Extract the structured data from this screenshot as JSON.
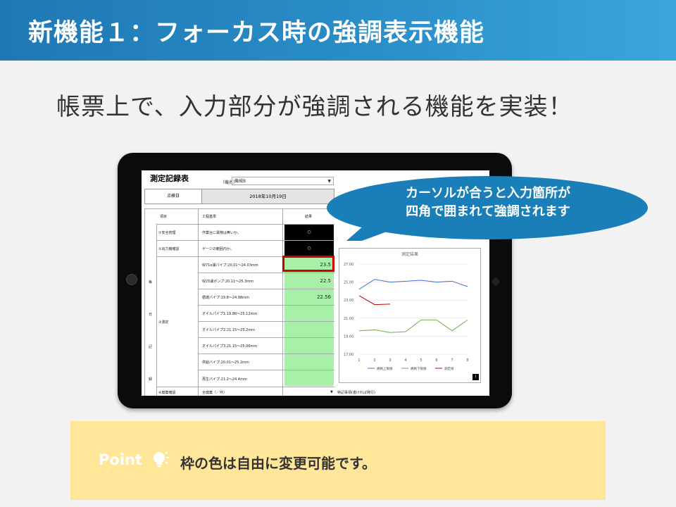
{
  "slide": {
    "title": "新機能１：フォーカス時の強調表示機能",
    "subtitle": "帳票上で、入力部分が強調される機能を実装！",
    "colors": {
      "header": "#1f78b4",
      "bubble": "#1a7fb8",
      "point_bg": "#ffe699",
      "highlight_frame": "#cc0000",
      "input_green": "#a8f0a8"
    }
  },
  "form": {
    "title": "測定記録表",
    "machine_label": "（機名）",
    "machine_value": "機械B",
    "date_label": "点検日",
    "date_value": "2018年10月19日",
    "headers": {
      "item": "項目",
      "standard": "工程基準",
      "result": "結果"
    },
    "left_vertical": [
      "毎",
      "日",
      "記",
      "録"
    ],
    "groups": [
      {
        "name": "①安全管理",
        "rows": [
          {
            "standard": "作業台に異物は無いか。",
            "value": "○",
            "style": "black"
          }
        ]
      },
      {
        "name": "②出力機確認",
        "rows": [
          {
            "standard": "ゲージの範囲内か。",
            "value": "○",
            "style": "black"
          }
        ]
      },
      {
        "name": "③測定",
        "rows": [
          {
            "standard": "W71α濾パイプ:20.01〜24.03mm",
            "value": "23.5",
            "style": "green",
            "focused": true
          },
          {
            "standard": "W25濾ポンプ:20.11〜25.3mm",
            "value": "22.5",
            "style": "green"
          },
          {
            "standard": "循環パイプ:19.8〜24.98mm",
            "value": "22.56",
            "style": "green"
          },
          {
            "standard": "オイルパイプ1:19.86〜25.12mm",
            "value": "",
            "style": "green"
          },
          {
            "standard": "オイルパイプ2:21.15〜25.2mm",
            "value": "",
            "style": "green"
          },
          {
            "standard": "オイルパイプ3:21.15〜25.06mm",
            "value": "",
            "style": "green"
          },
          {
            "standard": "供給パイプ:20.01〜25.2mm",
            "value": "",
            "style": "green"
          },
          {
            "standard": "再生パイプ:21.2〜24.4mm",
            "value": "",
            "style": "green"
          }
        ]
      },
      {
        "name": "④廃棄確認",
        "rows": [
          {
            "standard": "全廃棄（／件）",
            "value": "",
            "style": "plain"
          }
        ]
      }
    ],
    "footer_note": "特記事項(書ければ発行)"
  },
  "chart_data": {
    "type": "line",
    "title": "測定結果",
    "x": [
      1,
      2,
      3,
      4,
      5,
      6,
      7,
      8
    ],
    "ylim": [
      17.0,
      27.0
    ],
    "yticks": [
      "27.00",
      "25.00",
      "23.00",
      "21.00",
      "19.00",
      "17.00"
    ],
    "series": [
      {
        "name": "規格上限値",
        "color": "#4472c4",
        "values": [
          24.2,
          25.3,
          25.0,
          25.1,
          25.2,
          25.0,
          25.1,
          24.5
        ]
      },
      {
        "name": "規格下限値",
        "color": "#70ad47",
        "values": [
          19.6,
          19.7,
          19.4,
          19.5,
          20.8,
          20.8,
          19.6,
          20.8
        ]
      },
      {
        "name": "測定値",
        "color": "#c00000",
        "values": [
          23.5,
          22.5,
          22.56,
          null,
          null,
          null,
          null,
          null
        ]
      }
    ],
    "legend_position": "bottom",
    "grid": true
  },
  "callout": {
    "line1": "カーソルが合うと入力箇所が",
    "line2": "四角で囲まれて強調されます"
  },
  "point": {
    "label": "Point",
    "icon": "lightbulb-icon",
    "text": "枠の色は自由に変更可能です。"
  }
}
